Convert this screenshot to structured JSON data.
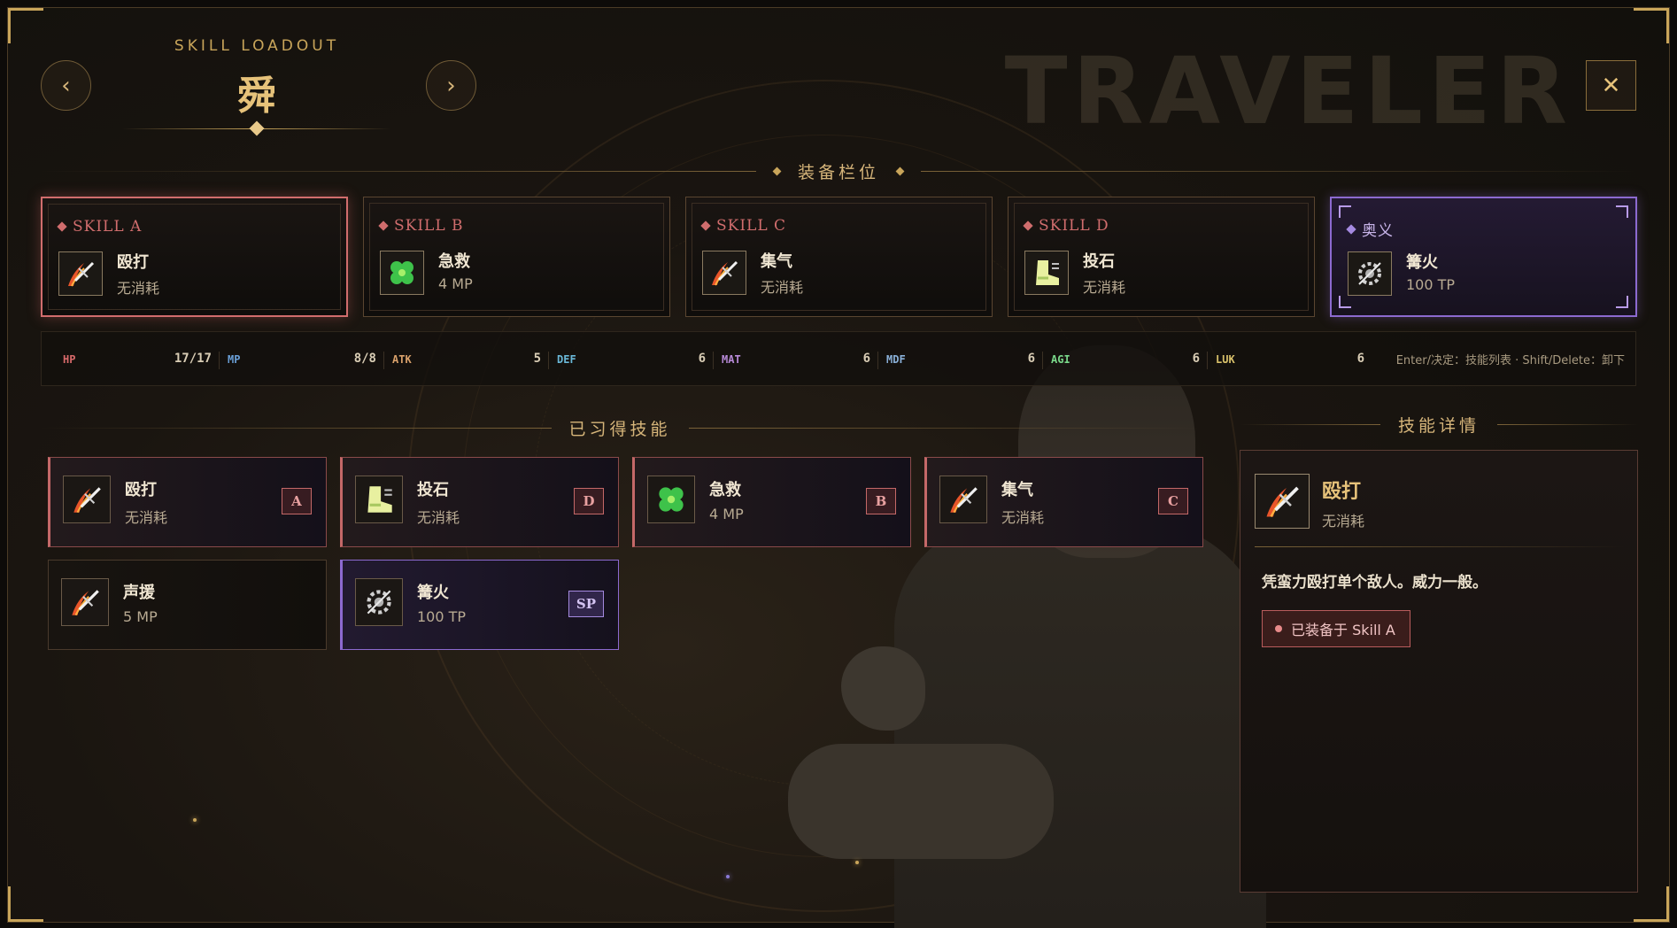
{
  "header": {
    "subtitle": "SKILL LOADOUT",
    "character_name": "舜",
    "watermark": "TRAVELER",
    "prev_label": "‹",
    "next_label": "›",
    "close_label": "✕"
  },
  "sections": {
    "equip_slots": "装备栏位",
    "learned_skills": "已习得技能",
    "skill_detail": "技能详情"
  },
  "equip_slots": [
    {
      "label": "SKILL A",
      "name": "殴打",
      "cost": "无消耗",
      "icon": "sword-slash-icon",
      "state": "active"
    },
    {
      "label": "SKILL B",
      "name": "急救",
      "cost": "4 MP",
      "icon": "clover-icon",
      "state": "normal"
    },
    {
      "label": "SKILL C",
      "name": "集气",
      "cost": "无消耗",
      "icon": "sword-slash-icon",
      "state": "normal"
    },
    {
      "label": "SKILL D",
      "name": "投石",
      "cost": "无消耗",
      "icon": "boot-icon",
      "state": "normal"
    },
    {
      "label": "奥义",
      "name": "篝火",
      "cost": "100 TP",
      "icon": "gear-burst-icon",
      "state": "special"
    }
  ],
  "stats": [
    {
      "key": "HP",
      "value": "17/17",
      "color": "#d86a6a"
    },
    {
      "key": "MP",
      "value": "8/8",
      "color": "#6aa0d8"
    },
    {
      "key": "ATK",
      "value": "5",
      "color": "#d8a06a"
    },
    {
      "key": "DEF",
      "value": "6",
      "color": "#6ab8d8"
    },
    {
      "key": "MAT",
      "value": "6",
      "color": "#b88ad8"
    },
    {
      "key": "MDF",
      "value": "6",
      "color": "#8ab0d8"
    },
    {
      "key": "AGI",
      "value": "6",
      "color": "#7ad88a"
    },
    {
      "key": "LUK",
      "value": "6",
      "color": "#d8c06a"
    }
  ],
  "hint": "Enter/决定：技能列表 · Shift/Delete：卸下",
  "learned_skills": [
    {
      "name": "殴打",
      "cost": "无消耗",
      "icon": "sword-slash-icon",
      "tag": "A",
      "style": "equipped"
    },
    {
      "name": "投石",
      "cost": "无消耗",
      "icon": "boot-icon",
      "tag": "D",
      "style": "equipped"
    },
    {
      "name": "急救",
      "cost": "4 MP",
      "icon": "clover-icon",
      "tag": "B",
      "style": "equipped"
    },
    {
      "name": "集气",
      "cost": "无消耗",
      "icon": "sword-slash-icon",
      "tag": "C",
      "style": "equipped"
    },
    {
      "name": "声援",
      "cost": "5 MP",
      "icon": "sword-slash-icon",
      "tag": "",
      "style": "plain"
    },
    {
      "name": "篝火",
      "cost": "100 TP",
      "icon": "gear-burst-icon",
      "tag": "SP",
      "style": "sp"
    }
  ],
  "detail": {
    "name": "殴打",
    "cost": "无消耗",
    "icon": "sword-slash-icon",
    "description": "凭蛮力殴打单个敌人。威力一般。",
    "equipped_badge": "已装备于 Skill A"
  },
  "colors": {
    "gold": "#c9a55a",
    "equipped_red": "#c46868",
    "special_purple": "#8c6ad0"
  }
}
